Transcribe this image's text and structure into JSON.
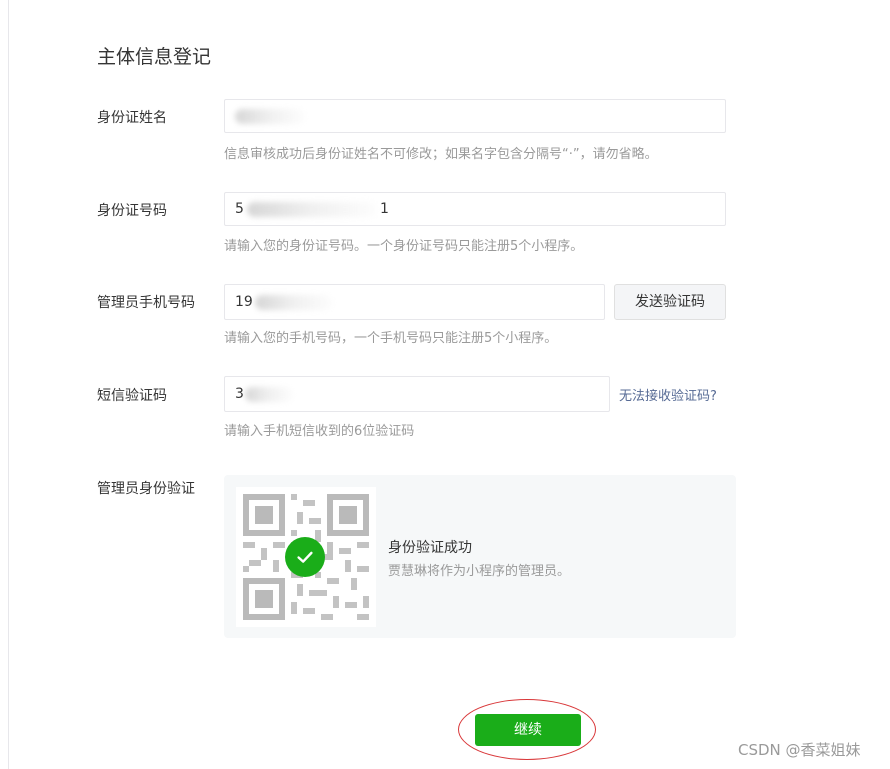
{
  "page": {
    "title": "主体信息登记"
  },
  "form": {
    "name": {
      "label": "身份证姓名",
      "value": "贾慧琳",
      "hint": "信息审核成功后身份证姓名不可修改；如果名字包含分隔号“·”，请勿省略。"
    },
    "id_number": {
      "label": "身份证号码",
      "value": "5",
      "value_tail": "1",
      "hint": "请输入您的身份证号码。一个身份证号码只能注册5个小程序。"
    },
    "phone": {
      "label": "管理员手机号码",
      "value": "19",
      "hint": "请输入您的手机号码，一个手机号码只能注册5个小程序。",
      "send_code_label": "发送验证码"
    },
    "sms_code": {
      "label": "短信验证码",
      "value": "3",
      "hint": "请输入手机短信收到的6位验证码",
      "help_link": "无法接收验证码?"
    },
    "admin_verify": {
      "label": "管理员身份验证",
      "status_title": "身份验证成功",
      "status_desc": "贾慧琳将作为小程序的管理员。"
    }
  },
  "actions": {
    "continue_label": "继续"
  },
  "watermark": "CSDN @香菜姐妹",
  "colors": {
    "accent_green": "#1aad19",
    "link_blue": "#576b95",
    "annotation_red": "#d9383a"
  }
}
